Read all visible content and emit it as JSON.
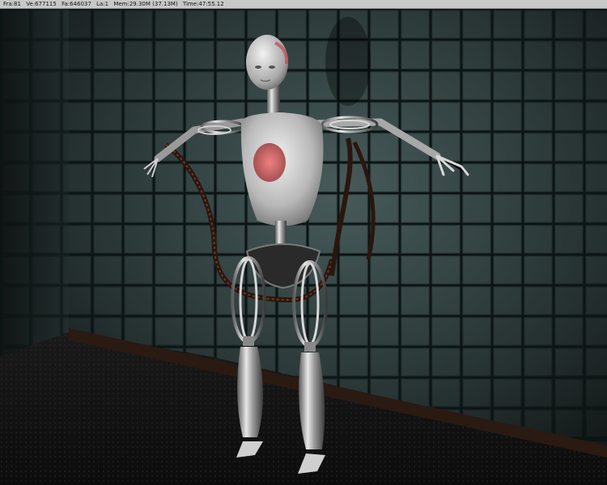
{
  "status": {
    "frame": "Fra:81",
    "vertices": "Ve:677115",
    "faces": "Fa:646037",
    "lamps": "La:1",
    "memory": "Mem:29.30M (37.13M)",
    "time": "Time:47:55.12"
  },
  "render": {
    "subject": "robot-figure",
    "background_color": "#0b0b0b",
    "wall_color": "#2a3a3a",
    "floor_color": "#141414",
    "accent_color": "#c0484a"
  }
}
